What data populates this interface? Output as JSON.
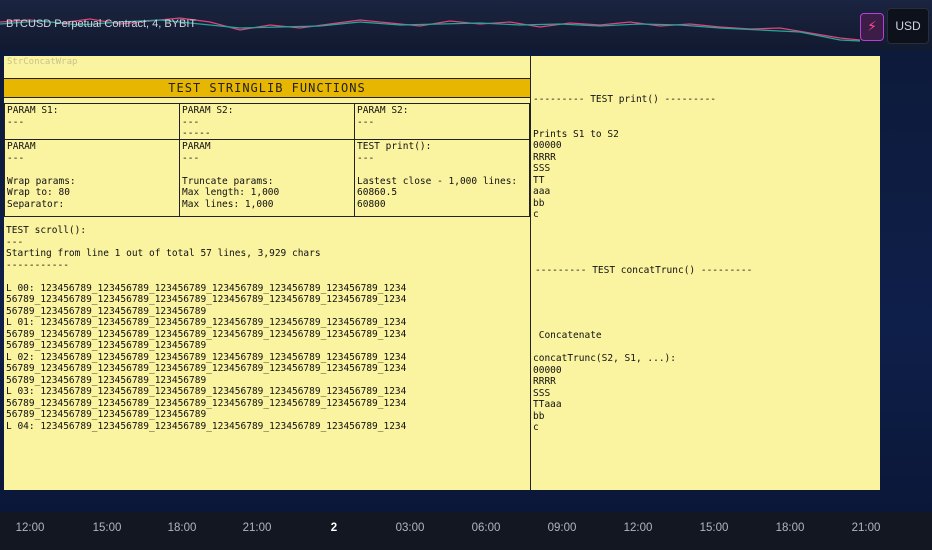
{
  "topbar": {
    "symbol": "BTCUSD Perpetual Contract, 4, BYBIT",
    "currency": "USD",
    "bolt_icon": "⚡"
  },
  "left": {
    "ghost": "StrConcatWrap",
    "header": "TEST STRINGLIB FUNCTIONS",
    "r1c1": "PARAM S1:\n---",
    "r1c2": "PARAM S2:\n---\n-----",
    "r1c3": "PARAM S2:\n---",
    "r2c1": "PARAM\n---\n\nWrap params:\nWrap to: 80\nSeparator:",
    "r2c2": "PARAM\n---\n\nTruncate params:\nMax length: 1,000\nMax lines: 1,000",
    "r2c3": "TEST print():\n---\n\nLastest close - 1,000 lines:\n60860.5\n60800",
    "scroll": "TEST scroll():\n---\nStarting from line 1 out of total 57 lines, 3,929 chars\n-----------\n\nL 00: 123456789_123456789_123456789_123456789_123456789_123456789_1234\n56789_123456789_123456789_123456789_123456789_123456789_123456789_1234\n56789_123456789_123456789_123456789\nL 01: 123456789_123456789_123456789_123456789_123456789_123456789_1234\n56789_123456789_123456789_123456789_123456789_123456789_123456789_1234\n56789_123456789_123456789_123456789\nL 02: 123456789_123456789_123456789_123456789_123456789_123456789_1234\n56789_123456789_123456789_123456789_123456789_123456789_123456789_1234\n56789_123456789_123456789_123456789\nL 03: 123456789_123456789_123456789_123456789_123456789_123456789_1234\n56789_123456789_123456789_123456789_123456789_123456789_123456789_1234\n56789_123456789_123456789_123456789\nL 04: 123456789_123456789_123456789_123456789_123456789_123456789_1234"
  },
  "right": {
    "block1": "--------- TEST print() ---------\n\n\nPrints S1 to S2\n00000\nRRRR\nSSS\nTT\naaa\nbb\nc",
    "block2": "--------- TEST concatTrunc() ---------",
    "block3": " Concatenate\n\nconcatTrunc(S2, S1, ...):\n00000\nRRRR\nSSS\nTTaaa\nbb\nc"
  },
  "axis": {
    "ticks": [
      "12:00",
      "15:00",
      "18:00",
      "21:00",
      "2",
      "03:00",
      "06:00",
      "09:00",
      "12:00",
      "15:00",
      "18:00",
      "21:00"
    ]
  }
}
